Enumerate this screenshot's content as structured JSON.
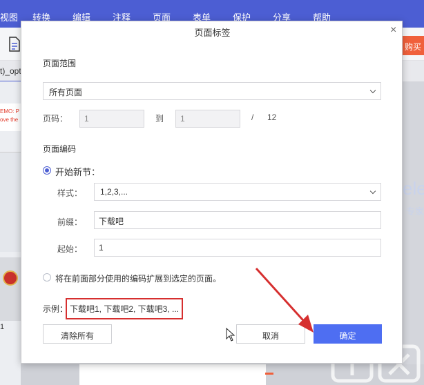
{
  "app": {
    "menu": [
      {
        "label": "视图"
      },
      {
        "label": "转换"
      },
      {
        "label": "编辑"
      },
      {
        "label": "注释"
      },
      {
        "label": "页面"
      },
      {
        "label": "表单"
      },
      {
        "label": "保护"
      },
      {
        "label": "分享"
      },
      {
        "label": "帮助"
      }
    ],
    "tab_fragment": "t)_opt",
    "thumb_text_1": "EMO: P",
    "thumb_text_2": "ove the",
    "thumb_page_number": "1",
    "orange_button_fragment": "购买",
    "right_watermark": "ele",
    "right_watermark_2": "专家"
  },
  "dialog": {
    "title": "页面标签",
    "range_section": "页面范围",
    "range_select": "所有页面",
    "page_label": "页码：",
    "page_from": "1",
    "to_label": "到",
    "page_to": "1",
    "slash": "/",
    "total_pages": "12",
    "numbering_section": "页面编码",
    "option_new_section": "开始新节：",
    "style_label": "样式：",
    "style_value": "1,2,3,...",
    "prefix_label": "前缀：",
    "prefix_value": "下载吧",
    "start_label": "起始：",
    "start_value": "1",
    "option_extend": "将在前面部分使用的编码扩展到选定的页面。",
    "example_label": "示例：",
    "example_value": "下载吧1, 下载吧2, 下载吧3, ...",
    "clear_button": "清除所有",
    "cancel_button": "取消",
    "ok_button": "确定"
  },
  "colors": {
    "accent": "#4c5ed3",
    "primary_button": "#4e6ef2",
    "highlight_red": "#d62f2f"
  },
  "icons": [
    "file-icon",
    "close-icon",
    "chevron-down-icon",
    "mouse-cursor-icon",
    "annotation-arrow-icon"
  ]
}
